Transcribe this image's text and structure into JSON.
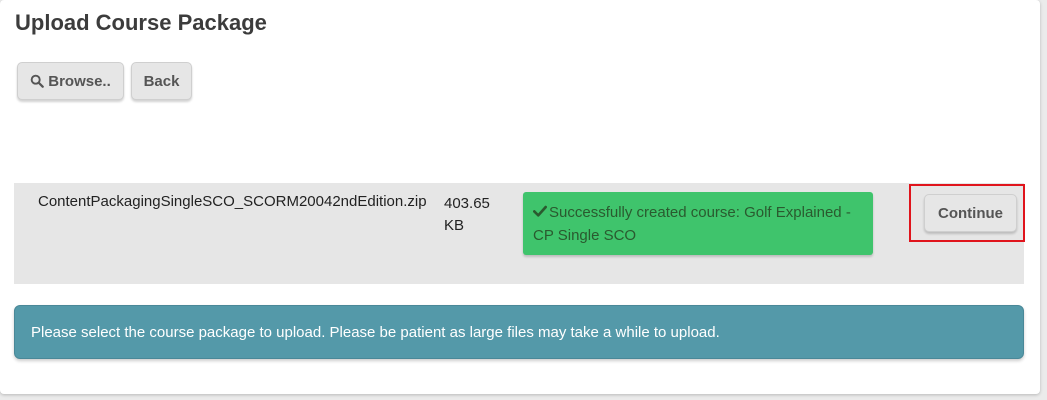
{
  "page": {
    "title": "Upload Course Package"
  },
  "toolbar": {
    "browse_label": "Browse..",
    "browse_icon": "search-icon",
    "back_label": "Back"
  },
  "upload": {
    "file_name": "ContentPackagingSingleSCO_SCORM20042ndEdition.zip",
    "file_size_value": "403.65",
    "file_size_unit": "KB",
    "status_icon": "check-icon",
    "status_message": "Successfully created course: Golf Explained - CP Single SCO",
    "continue_label": "Continue"
  },
  "info": {
    "message": "Please select the course package to upload. Please be patient as large files may take a while to upload."
  },
  "colors": {
    "success_background": "#3fc46c",
    "info_background": "#5499a9",
    "highlight_border": "#e0141c",
    "row_background": "#e6e6e6"
  }
}
